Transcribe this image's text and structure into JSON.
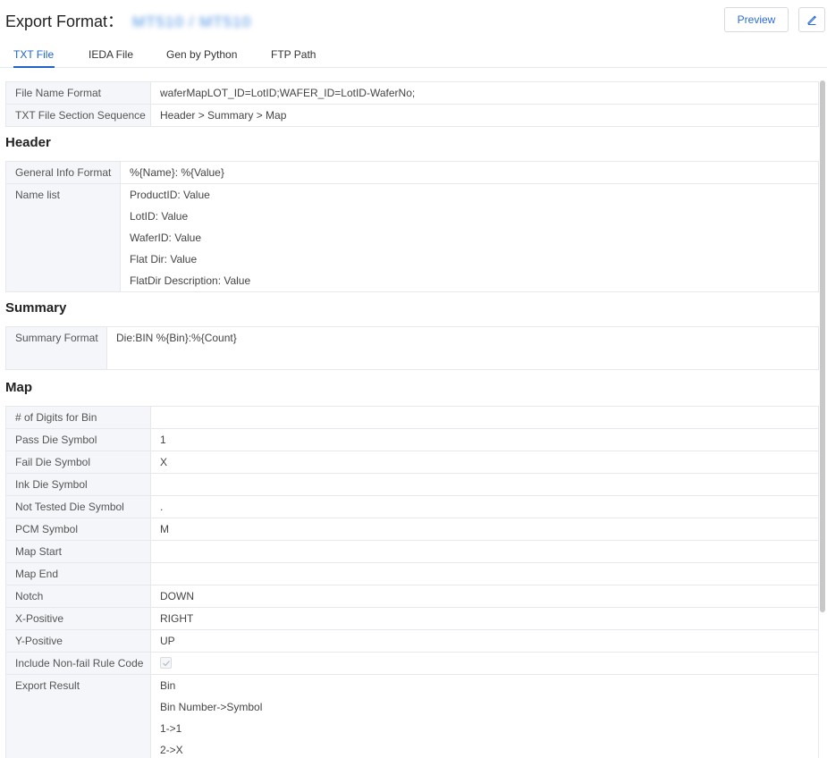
{
  "header": {
    "title": "Export Format：",
    "device": "MT510 / MT510",
    "preview_label": "Preview",
    "edit_icon": "pencil-icon"
  },
  "tabs": [
    {
      "label": "TXT File",
      "active": true
    },
    {
      "label": "IEDA File",
      "active": false
    },
    {
      "label": "Gen by Python",
      "active": false
    },
    {
      "label": "FTP Path",
      "active": false
    }
  ],
  "file_section": {
    "rows": [
      {
        "label": "File Name Format",
        "value": "waferMapLOT_ID=LotID;WAFER_ID=LotID-WaferNo;"
      },
      {
        "label": "TXT File Section Sequence",
        "value": "Header > Summary > Map"
      }
    ]
  },
  "header_section": {
    "title": "Header",
    "general_info": {
      "label": "General Info Format",
      "value": "%{Name}: %{Value}"
    },
    "name_list": {
      "label": "Name list",
      "values": [
        "ProductID: Value",
        "LotID: Value",
        "WaferID: Value",
        "Flat Dir: Value",
        "FlatDir Description: Value"
      ]
    }
  },
  "summary_section": {
    "title": "Summary",
    "row": {
      "label": "Summary Format",
      "value": "Die:BIN %{Bin}:%{Count}"
    }
  },
  "map_section": {
    "title": "Map",
    "rows": [
      {
        "label": "# of Digits for Bin",
        "value": ""
      },
      {
        "label": "Pass Die Symbol",
        "value": "1"
      },
      {
        "label": "Fail Die Symbol",
        "value": "X"
      },
      {
        "label": "Ink Die Symbol",
        "value": ""
      },
      {
        "label": "Not Tested Die Symbol",
        "value": "."
      },
      {
        "label": "PCM Symbol",
        "value": "M"
      },
      {
        "label": "Map Start",
        "value": ""
      },
      {
        "label": "Map End",
        "value": ""
      },
      {
        "label": "Notch",
        "value": "DOWN"
      },
      {
        "label": "X-Positive",
        "value": "RIGHT"
      },
      {
        "label": "Y-Positive",
        "value": "UP"
      }
    ],
    "non_fail": {
      "label": "Include Non-fail Rule Code",
      "checked": true
    },
    "export_result": {
      "label": "Export Result",
      "values": [
        "Bin",
        "Bin Number->Symbol",
        "1->1",
        "2->X"
      ]
    }
  },
  "colors": {
    "accent": "#1f63c9",
    "label_bg": "#f4f6f9",
    "border": "#e5e8ec"
  }
}
